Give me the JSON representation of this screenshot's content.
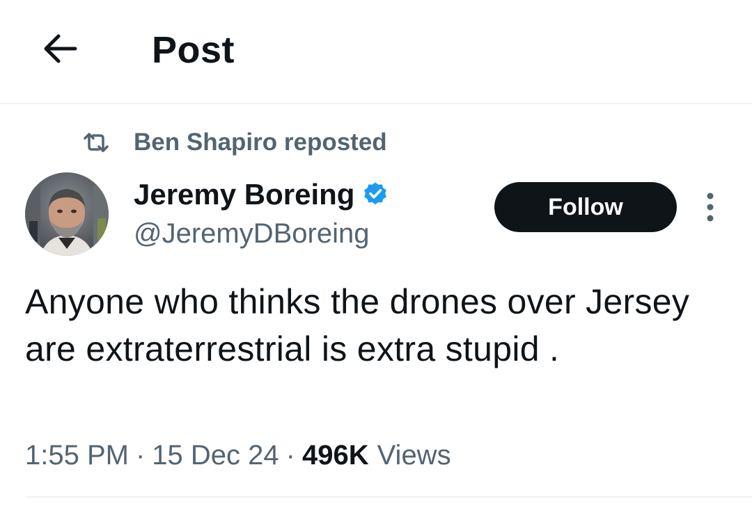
{
  "header": {
    "back_icon": "arrow-left-icon",
    "title": "Post"
  },
  "repost": {
    "icon": "repost-icon",
    "text": "Ben Shapiro reposted"
  },
  "author": {
    "name": "Jeremy Boreing",
    "handle": "@JeremyDBoreing",
    "verified_icon": "verified-badge-icon",
    "verified_color": "#1d9bf0"
  },
  "actions": {
    "follow_label": "Follow",
    "more_icon": "more-vertical-icon"
  },
  "tweet": {
    "text": "Anyone who thinks the drones over Jersey are extraterrestrial is extra stupid ."
  },
  "meta": {
    "time": "1:55 PM",
    "separator": "·",
    "date": "15 Dec 24",
    "views_count": "496K",
    "views_label": "Views"
  },
  "colors": {
    "text_primary": "#0f1419",
    "text_secondary": "#536471",
    "follow_bg": "#0f1419",
    "divider": "#eff3f4"
  }
}
